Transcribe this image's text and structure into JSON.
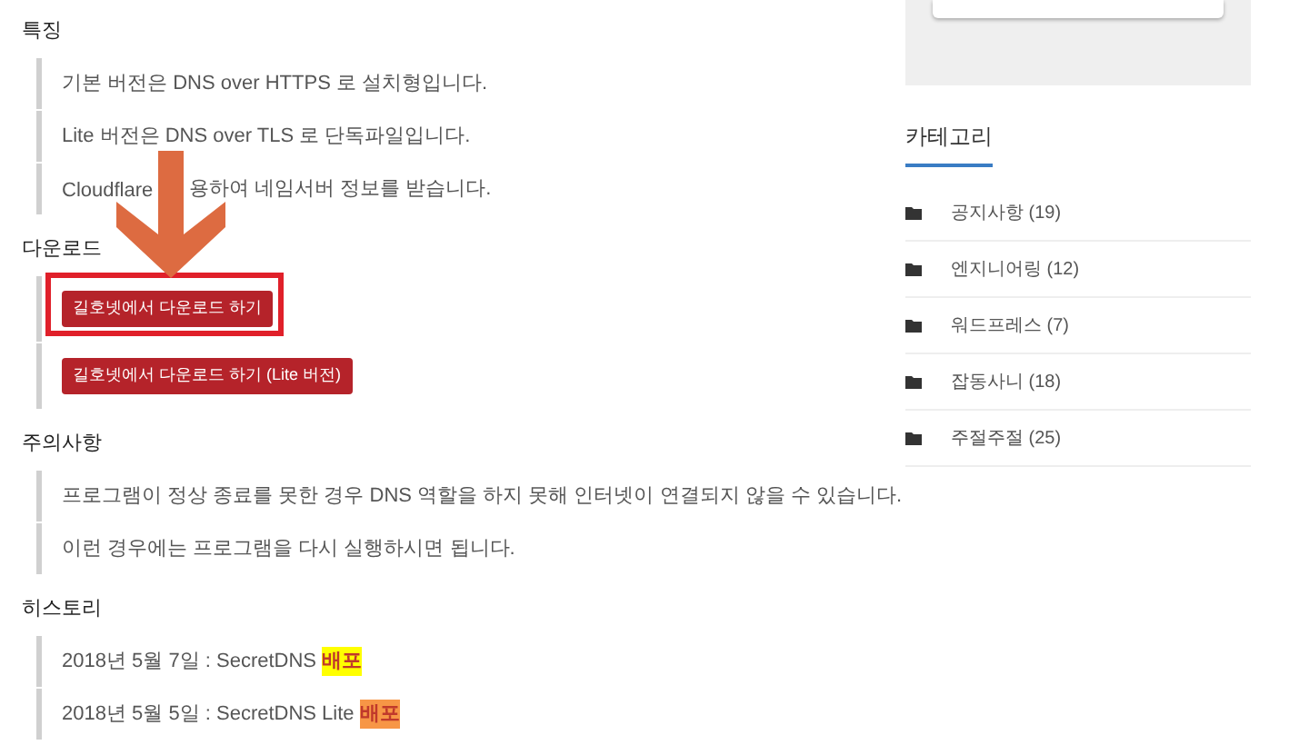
{
  "sections": [
    {
      "heading": "특징",
      "items": [
        {
          "kind": "text",
          "text": "기본 버전은 DNS over HTTPS 로 설치형입니다."
        },
        {
          "kind": "text",
          "text": "Lite 버전은 DNS over TLS 로 단독파일입니다."
        },
        {
          "kind": "covered",
          "text": "Cloudflare",
          "rest": "용하여 네임서버 정보를 받습니다."
        }
      ]
    },
    {
      "heading": "다운로드",
      "items": [
        {
          "kind": "button",
          "text": "길호넷에서 다운로드 하기",
          "marked": true
        },
        {
          "kind": "button",
          "text": "길호넷에서 다운로드 하기 (Lite 버전)",
          "marked": false
        }
      ]
    },
    {
      "heading": "주의사항",
      "items": [
        {
          "kind": "text",
          "text": "프로그램이 정상 종료를 못한 경우 DNS 역할을 하지 못해 인터넷이 연결되지 않을 수 있습니다."
        },
        {
          "kind": "text",
          "text": "이런 경우에는 프로그램을 다시 실행하시면 됩니다."
        }
      ]
    },
    {
      "heading": "히스토리",
      "items": [
        {
          "kind": "highlight",
          "text": "2018년 5월 7일 : SecretDNS",
          "mark": "배포",
          "color": "#ffff00"
        },
        {
          "kind": "highlight",
          "text": "2018년 5월 5일 : SecretDNS Lite",
          "mark": "배포",
          "color": "#f79646"
        }
      ]
    }
  ],
  "sidebar": {
    "title": "카테고리",
    "categories": [
      {
        "name": "공지사항",
        "count": "(19)"
      },
      {
        "name": "엔지니어링",
        "count": "(12)"
      },
      {
        "name": "워드프레스",
        "count": "(7)"
      },
      {
        "name": "잡동사니",
        "count": "(18)"
      },
      {
        "name": "주절주절",
        "count": "(25)"
      }
    ]
  }
}
